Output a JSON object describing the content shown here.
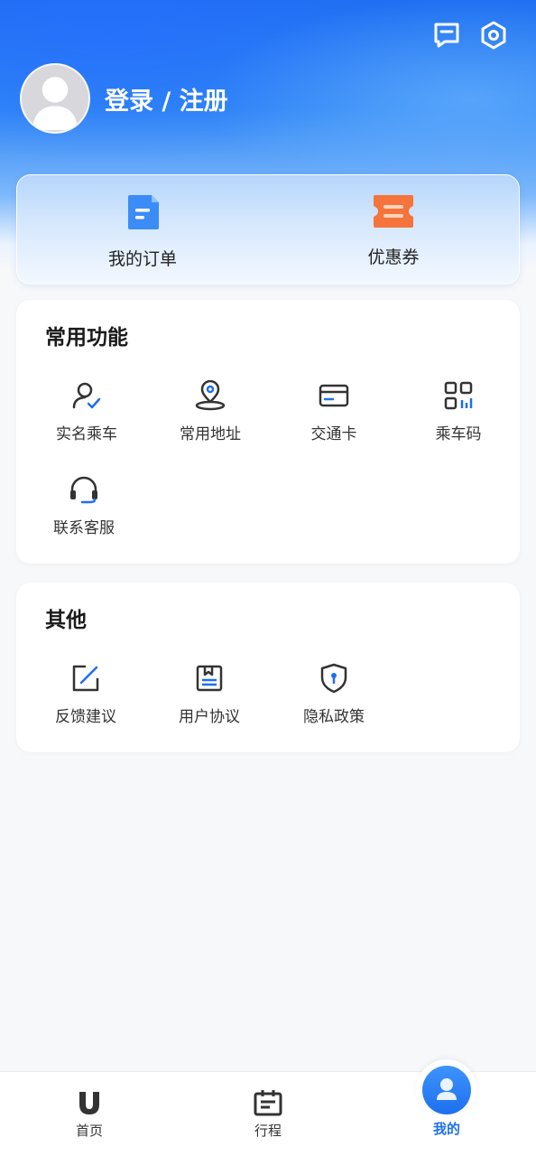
{
  "header": {
    "login_label": "登录 / 注册",
    "icons": [
      "message-icon",
      "settings-icon"
    ]
  },
  "quick_actions": [
    {
      "label": "我的订单",
      "icon": "order-icon",
      "color": "#3b8cf6"
    },
    {
      "label": "优惠券",
      "icon": "coupon-icon",
      "color": "#f4743b"
    }
  ],
  "common_functions": {
    "title": "常用功能",
    "items": [
      {
        "label": "实名乘车",
        "icon": "real-name-icon"
      },
      {
        "label": "常用地址",
        "icon": "location-icon"
      },
      {
        "label": "交通卡",
        "icon": "card-icon"
      },
      {
        "label": "乘车码",
        "icon": "qr-code-icon"
      },
      {
        "label": "联系客服",
        "icon": "headset-icon"
      }
    ]
  },
  "others": {
    "title": "其他",
    "items": [
      {
        "label": "反馈建议",
        "icon": "feedback-icon"
      },
      {
        "label": "用户协议",
        "icon": "agreement-icon"
      },
      {
        "label": "隐私政策",
        "icon": "privacy-shield-icon"
      }
    ]
  },
  "tabbar": {
    "items": [
      {
        "label": "首页",
        "icon": "home-icon",
        "active": false
      },
      {
        "label": "行程",
        "icon": "trip-icon",
        "active": false
      },
      {
        "label": "我的",
        "icon": "profile-icon",
        "active": true
      }
    ]
  },
  "colors": {
    "accent": "#1e6ff0",
    "accent_light": "#3b8cf6",
    "coupon": "#f4743b",
    "background": "#f7f8fa"
  }
}
